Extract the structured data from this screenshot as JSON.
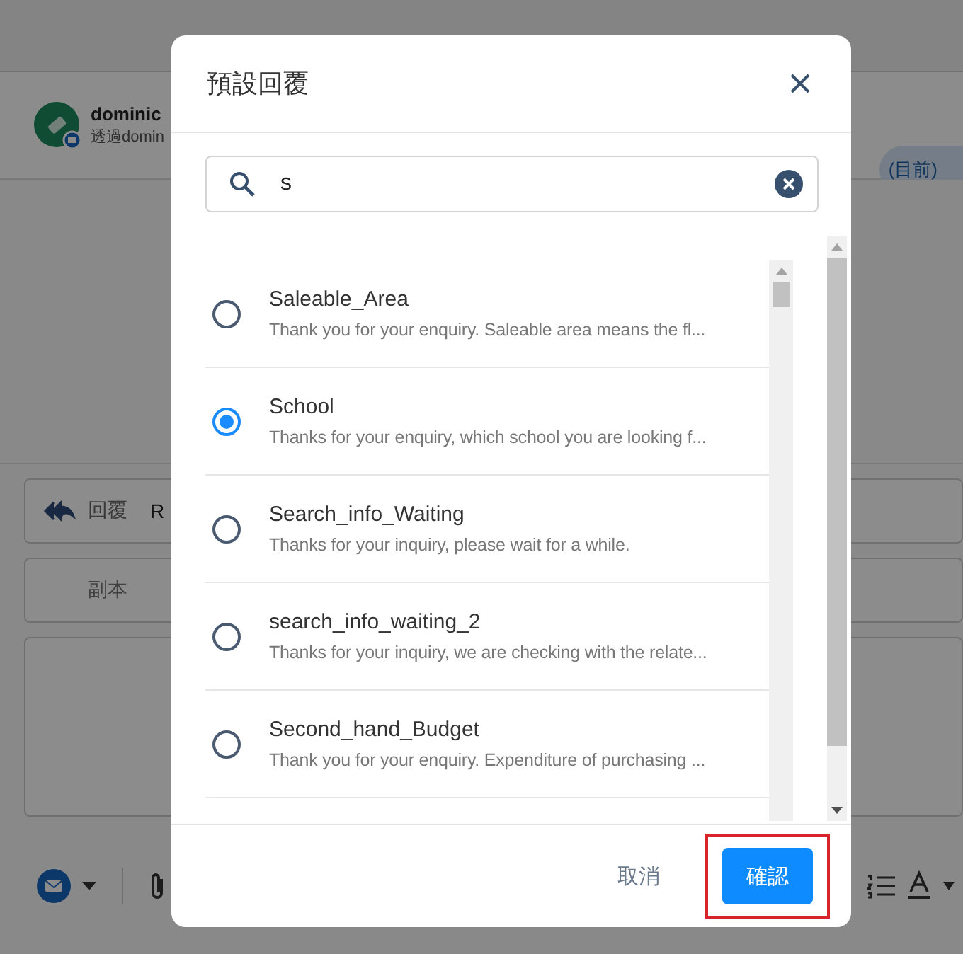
{
  "background": {
    "sender": "dominic",
    "via": "透過domin",
    "status": "(目前)",
    "reply_label": "回覆",
    "reply_value": "R",
    "cc_label": "副本"
  },
  "dialog": {
    "title": "預設回覆",
    "search": {
      "value": "s"
    },
    "replies": [
      {
        "title": "Saleable_Area",
        "preview": "Thank you for your enquiry. Saleable area means the fl...",
        "selected": false
      },
      {
        "title": "School",
        "preview": "Thanks for your enquiry, which school you are looking f...",
        "selected": true
      },
      {
        "title": "Search_info_Waiting",
        "preview": "Thanks for your inquiry, please wait for a while.",
        "selected": false
      },
      {
        "title": "search_info_waiting_2",
        "preview": "Thanks for your inquiry, we are checking with the relate...",
        "selected": false
      },
      {
        "title": "Second_hand_Budget",
        "preview": "Thank you for your enquiry. Expenditure of purchasing ...",
        "selected": false
      }
    ],
    "cancel": "取消",
    "confirm": "確認",
    "confirm_highlighted": true
  }
}
